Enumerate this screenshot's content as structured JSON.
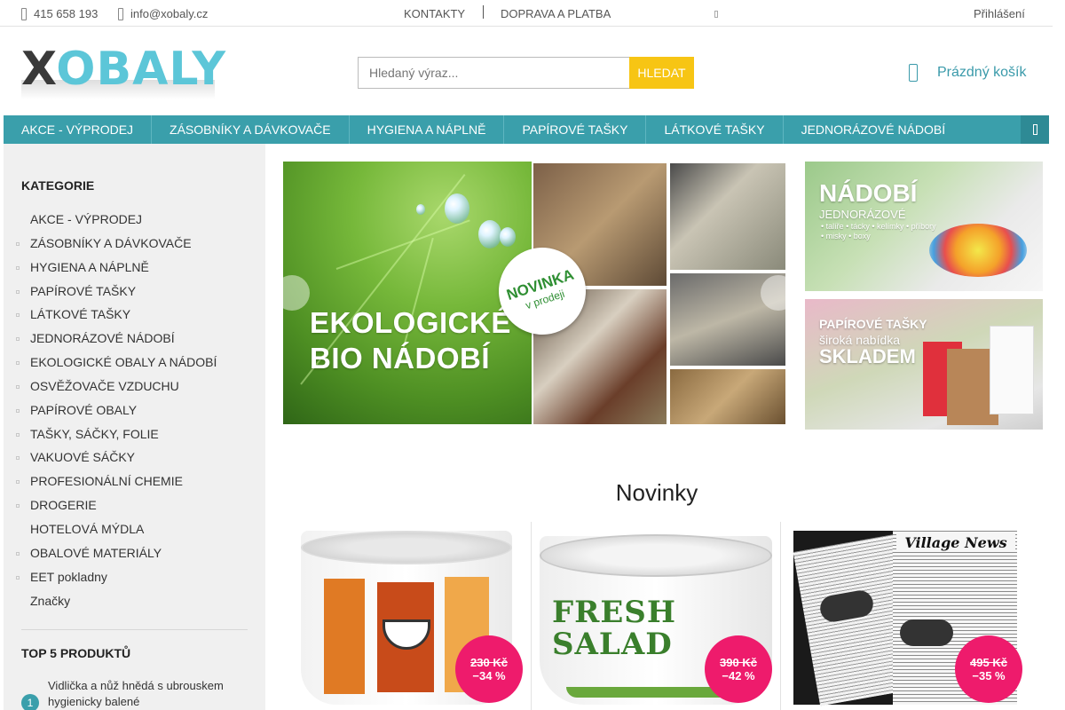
{
  "topbar": {
    "phone": "415 658 193",
    "email": "info@xobaly.cz",
    "links": [
      "KONTAKTY",
      "DOPRAVA A PLATBA"
    ],
    "login": "Přihlášení"
  },
  "logo": {
    "text_x": "X",
    "text_rest": "OBALY"
  },
  "search": {
    "placeholder": "Hledaný výraz...",
    "button": "HLEDAT"
  },
  "cart": {
    "label": "Prázdný košík"
  },
  "nav": {
    "items": [
      "AKCE - VÝPRODEJ",
      "ZÁSOBNÍKY A DÁVKOVAČE",
      "HYGIENA A NÁPLNĚ",
      "PAPÍROVÉ TAŠKY",
      "LÁTKOVÉ TAŠKY",
      "JEDNORÁZOVÉ NÁDOBÍ"
    ]
  },
  "sidebar": {
    "title": "KATEGORIE",
    "categories": [
      "AKCE - VÝPRODEJ",
      "ZÁSOBNÍKY A DÁVKOVAČE",
      "HYGIENA A NÁPLNĚ",
      "PAPÍROVÉ TAŠKY",
      "LÁTKOVÉ TAŠKY",
      "JEDNORÁZOVÉ NÁDOBÍ",
      "EKOLOGICKÉ OBALY A NÁDOBÍ",
      "OSVĚŽOVAČE VZDUCHU",
      "PAPÍROVÉ OBALY",
      "TAŠKY, SÁČKY, FOLIE",
      "VAKUOVÉ SÁČKY",
      "PROFESIONÁLNÍ CHEMIE",
      "DROGERIE",
      "HOTELOVÁ MÝDLA",
      "OBALOVÉ MATERIÁLY",
      "EET pokladny",
      "Značky"
    ],
    "top5_title": "TOP 5 PRODUKTŮ",
    "top5": [
      {
        "rank": "1",
        "name": "Vidlička a nůž hnědá s ubrouskem hygienicky balené"
      }
    ]
  },
  "banner": {
    "line1": "EKOLOGICKÉ",
    "line2": "BIO NÁDOBÍ",
    "badge_line1": "NOVINKA",
    "badge_line2": "v prodeji"
  },
  "side_banners": [
    {
      "title": "NÁDOBÍ",
      "subtitle": "JEDNORÁZOVÉ",
      "details": "• talíře  • tácky  • kelímky  • příbory  • misky  • boxy"
    },
    {
      "title": "PAPÍROVÉ TAŠKY",
      "subtitle": "široká nabídka",
      "highlight": "SKLADEM"
    }
  ],
  "novinky": {
    "title": "Novinky",
    "products": [
      {
        "old_price": "230 Kč",
        "discount": "−34 %"
      },
      {
        "old_price": "390 Kč",
        "discount": "−42 %",
        "print": "FRESH SALAD"
      },
      {
        "old_price": "495 Kč",
        "discount": "−35 %",
        "print": "Village News"
      }
    ]
  },
  "colors": {
    "accent": "#3a9fab",
    "search_button": "#f7c514",
    "sale": "#ee1b6c"
  }
}
